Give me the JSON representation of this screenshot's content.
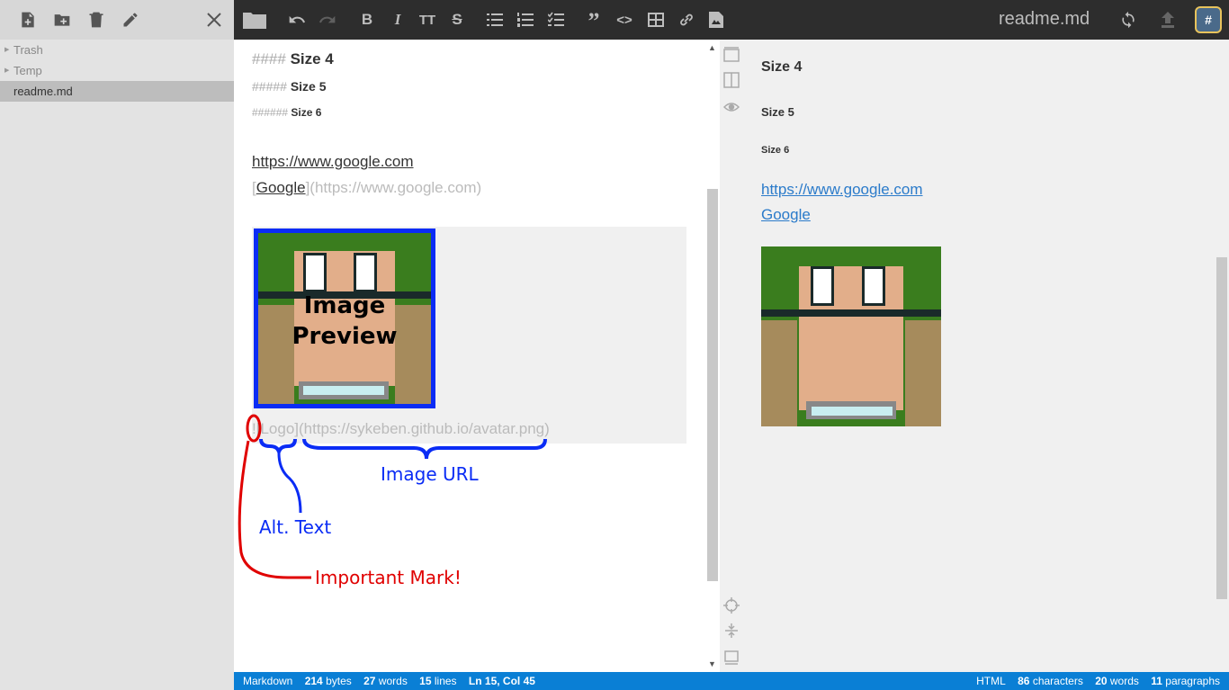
{
  "sidebar": {
    "toolbar": {
      "new_file_icon": "new-file-icon",
      "new_folder_icon": "new-folder-icon",
      "trash_icon": "trash-icon",
      "rename_icon": "pencil-icon",
      "close_icon": "close-icon"
    },
    "items": [
      {
        "label": "Trash",
        "folder": true
      },
      {
        "label": "Temp",
        "folder": true
      },
      {
        "label": "readme.md",
        "folder": false,
        "active": true
      }
    ]
  },
  "toolbar": {
    "filename": "readme.md",
    "avatar_text": "#",
    "bold": "B",
    "italic": "I",
    "heading": "TT",
    "strike": "S",
    "quote": "”",
    "code": "<>"
  },
  "editor": {
    "h4_prefix": "####",
    "h4_text": "Size 4",
    "h5_prefix": "#####",
    "h5_text": "Size 5",
    "h6_prefix": "######",
    "h6_text": "Size 6",
    "url_line": "https://www.google.com",
    "link_open": "[",
    "link_text": "Google",
    "link_rest": "](https://www.google.com)",
    "image_bang": "!",
    "image_rest": "[Logo](https://sykeben.github.io/avatar.png)",
    "preview_label_1": "Image",
    "preview_label_2": "Preview"
  },
  "annotations": {
    "image_url": "Image URL",
    "alt_text": "Alt. Text",
    "important": "Important Mark!",
    "blue": "#0a2cf5",
    "red": "#e00000"
  },
  "preview": {
    "h4": "Size 4",
    "h5": "Size 5",
    "h6": "Size 6",
    "url": "https://www.google.com",
    "link": "Google"
  },
  "statusbar": {
    "mode": "Markdown",
    "bytes": "214",
    "bytes_label": "bytes",
    "words": "27",
    "words_label": "words",
    "lines": "15",
    "lines_label": "lines",
    "cursor": "Ln 15, Col 45",
    "html_label": "HTML",
    "characters": "86",
    "characters_label": "characters",
    "html_words": "20",
    "html_words_label": "words",
    "paragraphs": "11",
    "paragraphs_label": "paragraphs"
  },
  "colors": {
    "toolbar_bg": "#2d2d2d",
    "status_bg": "#0a7fd5",
    "link_blue": "#2b7bca"
  }
}
